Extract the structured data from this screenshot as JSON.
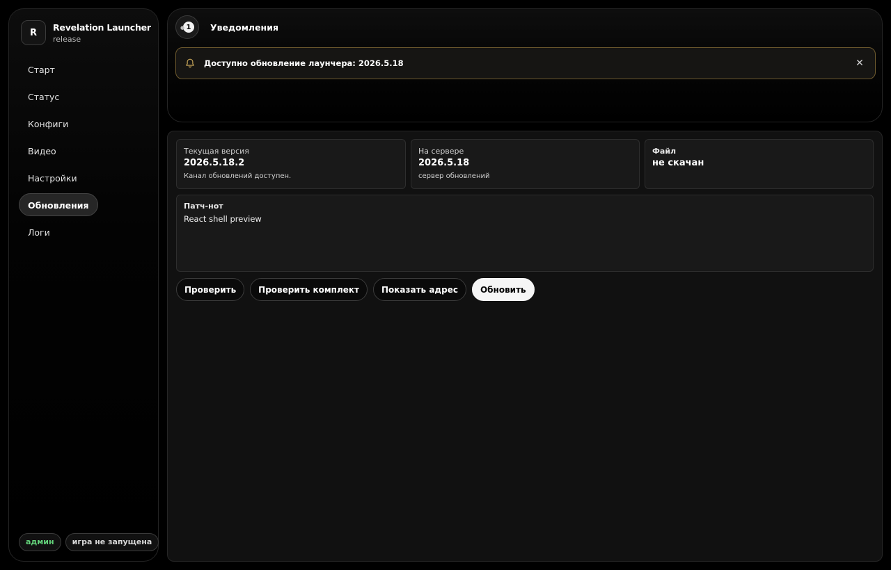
{
  "app": {
    "logo_letter": "R",
    "title": "Revelation Launcher",
    "channel": "release"
  },
  "nav": {
    "items": [
      {
        "label": "Старт"
      },
      {
        "label": "Статус"
      },
      {
        "label": "Конфиги"
      },
      {
        "label": "Видео"
      },
      {
        "label": "Настройки"
      },
      {
        "label": "Обновления",
        "active": true
      },
      {
        "label": "Логи"
      }
    ]
  },
  "footer": {
    "role_chip": "админ",
    "game_chip": "игра не запущена"
  },
  "notifications": {
    "title": "Уведомления",
    "count": "1",
    "alert_text": "Доступно обновление лаунчера: 2026.5.18",
    "close_glyph": "✕"
  },
  "updates": {
    "current": {
      "label": "Текущая версия",
      "value": "2026.5.18.2",
      "sub": "Канал обновлений доступен."
    },
    "server": {
      "label": "На сервере",
      "value": "2026.5.18",
      "sub": "сервер обновлений"
    },
    "file": {
      "label": "Файл",
      "value": "не скачан"
    },
    "patch": {
      "title": "Патч-нот",
      "text": "React shell preview"
    },
    "buttons": {
      "check": "Проверить",
      "check_bundle": "Проверить комплект",
      "show_address": "Показать адрес",
      "update": "Обновить"
    }
  },
  "colors": {
    "accent_green": "#63d27a",
    "alert_border": "#6e5a2e"
  }
}
